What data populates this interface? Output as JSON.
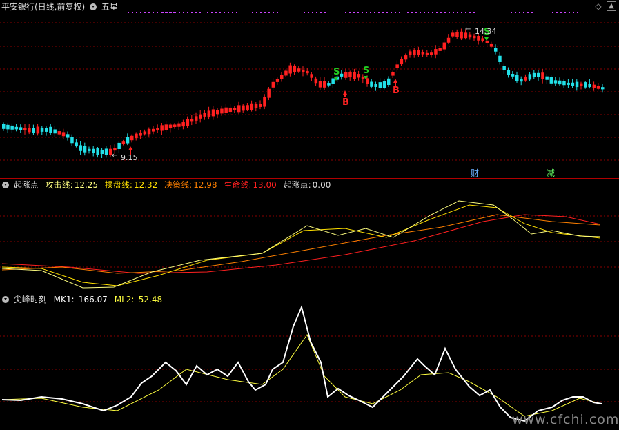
{
  "main_panel": {
    "title": "平安银行(日线,前复权)",
    "indicator": "五星",
    "low_label": "9.15",
    "high_label": "14.34",
    "signals": [
      {
        "type": "S",
        "color": "#22cc22"
      },
      {
        "type": "S",
        "color": "#22cc22"
      },
      {
        "type": "S",
        "color": "#22cc22"
      },
      {
        "type": "B",
        "color": "#ff2222"
      },
      {
        "type": "B",
        "color": "#ff2222"
      }
    ],
    "badges": [
      "财",
      "减"
    ],
    "colors": {
      "up": "#ff2020",
      "down": "#22e0e8",
      "grid": "#8a0000"
    }
  },
  "panel2": {
    "name": "起涨点",
    "series": [
      {
        "label": "攻击线:",
        "value": "12.25",
        "color": "#ffff80"
      },
      {
        "label": "操盘线:",
        "value": "12.32",
        "color": "#ffe000"
      },
      {
        "label": "决策线:",
        "value": "12.98",
        "color": "#ff8000"
      },
      {
        "label": "生命线:",
        "value": "13.00",
        "color": "#ff2020"
      },
      {
        "label": "起涨点:",
        "value": "0.00",
        "color": "#dddddd"
      }
    ]
  },
  "panel3": {
    "name": "尖峰时刻",
    "series": [
      {
        "label": "MK1:",
        "value": "-166.07",
        "color": "#ffffff"
      },
      {
        "label": "ML2:",
        "value": "-52.48",
        "color": "#ffff40"
      }
    ]
  },
  "watermark": "www.cfchi.com",
  "icons": [
    "settings-dropdown-icon",
    "diamond-icon",
    "expand-icon"
  ]
}
